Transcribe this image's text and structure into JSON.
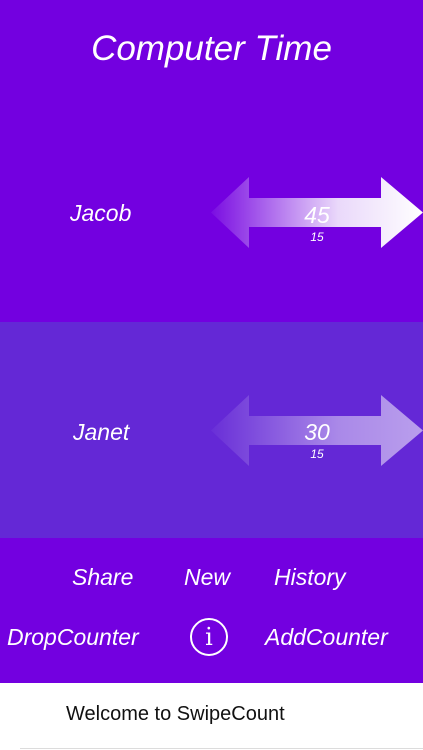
{
  "header": {
    "title": "Computer Time"
  },
  "counters": [
    {
      "name": "Jacob",
      "value": "45",
      "step": "15"
    },
    {
      "name": "Janet",
      "value": "30",
      "step": "15"
    }
  ],
  "toolbar": {
    "share": "Share",
    "new": "New",
    "history": "History",
    "drop_counter": "DropCounter",
    "info_icon_glyph": "i",
    "add_counter": "AddCounter"
  },
  "footer": {
    "welcome": "Welcome to SwipeCount"
  },
  "colors": {
    "primary": "#7300e0",
    "counter_alt": "#6428d6",
    "text": "#ffffff"
  }
}
